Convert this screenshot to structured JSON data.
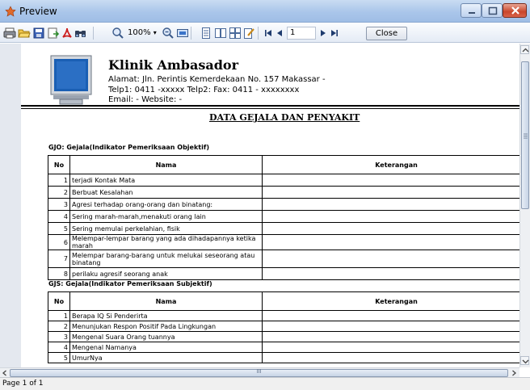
{
  "window": {
    "title": "Preview"
  },
  "toolbar": {
    "zoom_value": "100%",
    "page_value": "1",
    "close_label": "Close"
  },
  "report": {
    "clinic_name": "Klinik Ambasador",
    "address_line": "Alamat: Jln. Perintis Kemerdekaan No. 157 Makassar -",
    "phone_line": "Telp1: 0411 -xxxxx Telp2:  Fax: 0411 - xxxxxxxx",
    "email_line": "Email: -  Website: -",
    "title": "DATA GEJALA DAN PENYAKIT",
    "sections": [
      {
        "title": "GJO: Gejala(Indikator Pemeriksaan Objektif)",
        "headers": {
          "no": "No",
          "nama": "Nama",
          "keterangan": "Keterangan"
        },
        "rows": [
          {
            "no": "1",
            "nama": "terjadi Kontak Mata",
            "keterangan": ""
          },
          {
            "no": "2",
            "nama": "Berbuat Kesalahan",
            "keterangan": ""
          },
          {
            "no": "3",
            "nama": "Agresi terhadap orang-orang dan binatang:",
            "keterangan": ""
          },
          {
            "no": "4",
            "nama": "Sering marah-marah,menakuti orang lain",
            "keterangan": ""
          },
          {
            "no": "5",
            "nama": "Sering memulai perkelahian, fisik",
            "keterangan": ""
          },
          {
            "no": "6",
            "nama": "Melempar-lempar barang yang ada dihadapannya ketika marah",
            "keterangan": ""
          },
          {
            "no": "7",
            "nama": "Melempar barang-barang untuk melukai seseorang atau binatang",
            "keterangan": ""
          },
          {
            "no": "8",
            "nama": "perilaku agresif seorang anak",
            "keterangan": ""
          }
        ]
      },
      {
        "title": "GJS: Gejala(Indikator Pemeriksaan Subjektif)",
        "headers": {
          "no": "No",
          "nama": "Nama",
          "keterangan": "Keterangan"
        },
        "rows": [
          {
            "no": "1",
            "nama": "Berapa IQ Si Penderirta",
            "keterangan": ""
          },
          {
            "no": "2",
            "nama": "Menunjukan Respon Positif Pada Lingkungan",
            "keterangan": ""
          },
          {
            "no": "3",
            "nama": "Mengenal Suara Orang tuannya",
            "keterangan": ""
          },
          {
            "no": "4",
            "nama": "Mengenal Namanya",
            "keterangan": ""
          },
          {
            "no": "5",
            "nama": "UmurNya",
            "keterangan": ""
          }
        ]
      }
    ]
  },
  "scroll": {
    "h_center": "III"
  },
  "status": {
    "page_text": "Page 1 of 1"
  }
}
